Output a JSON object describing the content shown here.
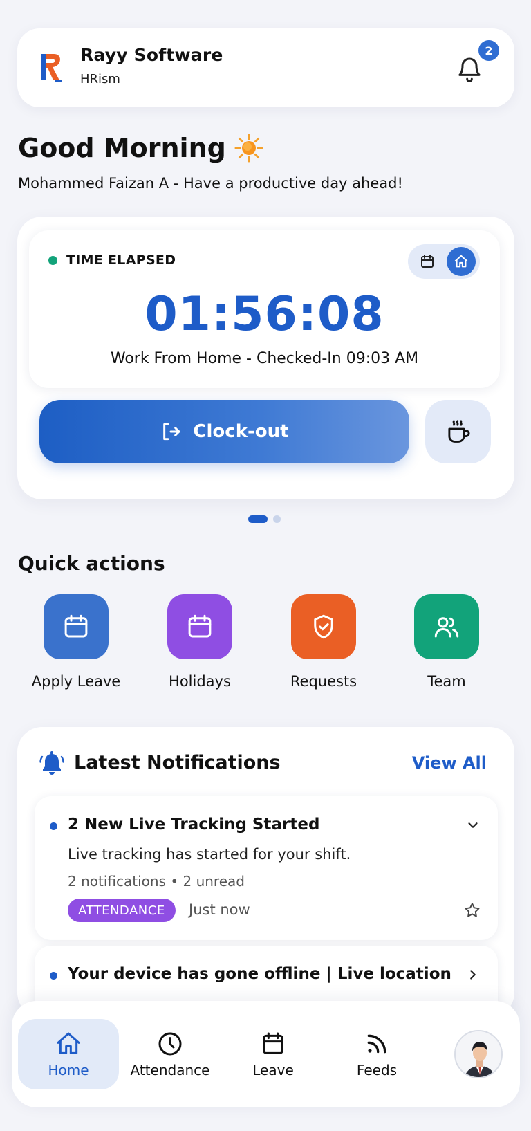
{
  "header": {
    "company_name": "Rayy Software",
    "company_sub": "HRism",
    "notification_count": "2"
  },
  "greeting": {
    "title": "Good Morning",
    "subtitle": "Mohammed Faizan A - Have a productive day ahead!"
  },
  "timer": {
    "label": "TIME ELAPSED",
    "value": "01:56:08",
    "status": "Work From Home - Checked-In 09:03 AM",
    "clockout_label": "Clock-out"
  },
  "pager": {
    "total": 2,
    "active": 1
  },
  "quick_actions": {
    "title": "Quick actions",
    "items": [
      {
        "label": "Apply Leave",
        "icon": "calendar-icon",
        "color": "#3a72cc"
      },
      {
        "label": "Holidays",
        "icon": "calendar-icon",
        "color": "#8f4ee3"
      },
      {
        "label": "Requests",
        "icon": "shield-check-icon",
        "color": "#ea5f25"
      },
      {
        "label": "Team",
        "icon": "users-icon",
        "color": "#12a37a"
      }
    ]
  },
  "notifications": {
    "title": "Latest Notifications",
    "view_all": "View All",
    "items": [
      {
        "title": "2 New Live Tracking Started",
        "description": "Live tracking has started for your shift.",
        "meta": "2 notifications • 2 unread",
        "tag": "ATTENDANCE",
        "time": "Just now"
      },
      {
        "title": "Your device has gone offline | Live location"
      }
    ]
  },
  "nav": {
    "items": [
      {
        "label": "Home"
      },
      {
        "label": "Attendance"
      },
      {
        "label": "Leave"
      },
      {
        "label": "Feeds"
      }
    ]
  },
  "colors": {
    "primary": "#1e5cc8",
    "success": "#12a37a",
    "background": "#f3f4f9"
  }
}
